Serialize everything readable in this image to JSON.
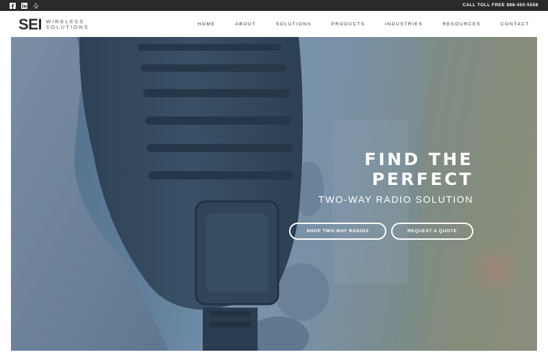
{
  "topbar": {
    "social_icons": [
      "facebook-icon",
      "linkedin-icon",
      "yelp-icon"
    ],
    "toll_free": "CALL TOLL FREE 888-450-5558"
  },
  "header": {
    "logo_mark": "SEI",
    "logo_line1": "WIRELESS",
    "logo_line2": "SOLUTIONS",
    "nav": [
      "HOME",
      "ABOUT",
      "SOLUTIONS",
      "PRODUCTS",
      "INDUSTRIES",
      "RESOURCES",
      "CONTACT"
    ]
  },
  "hero": {
    "headline_line1": "FIND THE",
    "headline_line2": "PERFECT",
    "subline": "TWO-WAY RADIO SOLUTION",
    "cta_primary": "SHOP TWO-WAY RADIOS",
    "cta_secondary": "REQUEST A QUOTE"
  },
  "colors": {
    "topbar_bg": "#2a2a2a",
    "text_dark": "#333333",
    "hero_tint": "#5a7792",
    "white": "#ffffff"
  }
}
